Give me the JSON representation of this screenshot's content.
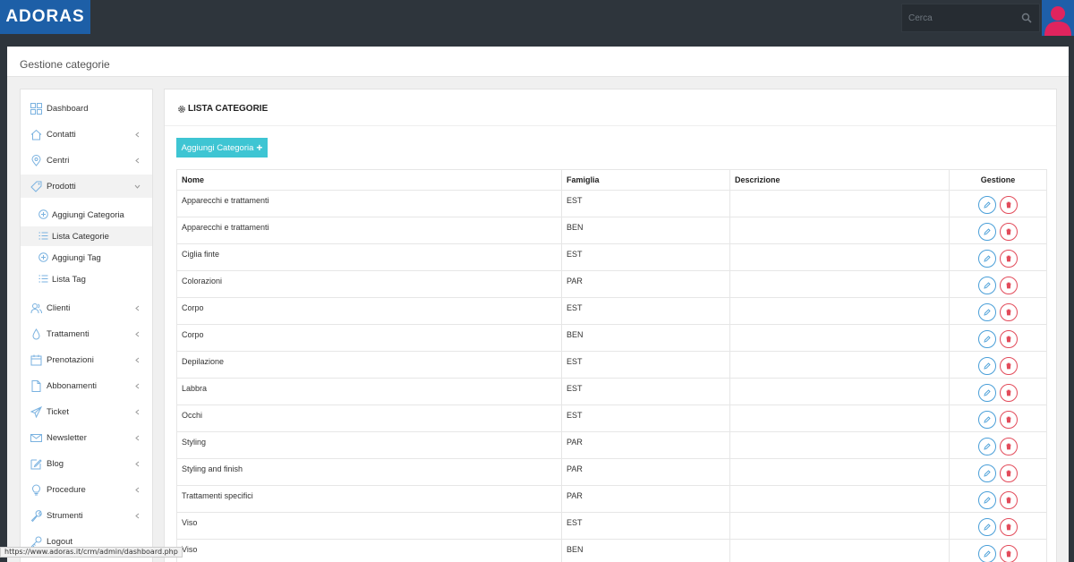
{
  "brand": {
    "logo_text": "ADORAS",
    "logo_color": "#1d5fa7"
  },
  "search": {
    "placeholder": "Cerca",
    "value": ""
  },
  "page": {
    "title": "Gestione categorie"
  },
  "sidebar": {
    "items": [
      {
        "label": "Dashboard",
        "icon": "dashboard-icon",
        "has_submenu": false
      },
      {
        "label": "Contatti",
        "icon": "home-icon",
        "has_submenu": true
      },
      {
        "label": "Centri",
        "icon": "map-pin-icon",
        "has_submenu": true
      },
      {
        "label": "Prodotti",
        "icon": "tag-icon",
        "has_submenu": true,
        "expanded": true,
        "children": [
          {
            "label": "Aggiungi Categoria",
            "icon": "plus-circle-icon"
          },
          {
            "label": "Lista Categorie",
            "icon": "list-icon",
            "active": true
          },
          {
            "label": "Aggiungi Tag",
            "icon": "plus-circle-icon"
          },
          {
            "label": "Lista Tag",
            "icon": "list-icon"
          }
        ]
      },
      {
        "label": "Clienti",
        "icon": "users-icon",
        "has_submenu": true
      },
      {
        "label": "Trattamenti",
        "icon": "drop-icon",
        "has_submenu": true
      },
      {
        "label": "Prenotazioni",
        "icon": "calendar-icon",
        "has_submenu": true
      },
      {
        "label": "Abbonamenti",
        "icon": "document-icon",
        "has_submenu": true
      },
      {
        "label": "Ticket",
        "icon": "paper-plane-icon",
        "has_submenu": true
      },
      {
        "label": "Newsletter",
        "icon": "envelope-icon",
        "has_submenu": true
      },
      {
        "label": "Blog",
        "icon": "edit-icon",
        "has_submenu": true
      },
      {
        "label": "Procedure",
        "icon": "bulb-icon",
        "has_submenu": true
      },
      {
        "label": "Strumenti",
        "icon": "wrench-icon",
        "has_submenu": true
      },
      {
        "label": "Logout",
        "icon": "key-icon",
        "has_submenu": false
      }
    ]
  },
  "panel": {
    "title": "LISTA CATEGORIE",
    "add_button_label": "Aggiungi Categoria",
    "columns": [
      "Nome",
      "Famiglia",
      "Descrizione",
      "Gestione"
    ],
    "rows": [
      {
        "nome": "Apparecchi e trattamenti",
        "famiglia": "EST",
        "descrizione": ""
      },
      {
        "nome": "Apparecchi e trattamenti",
        "famiglia": "BEN",
        "descrizione": ""
      },
      {
        "nome": "Ciglia finte",
        "famiglia": "EST",
        "descrizione": ""
      },
      {
        "nome": "Colorazioni",
        "famiglia": "PAR",
        "descrizione": ""
      },
      {
        "nome": "Corpo",
        "famiglia": "EST",
        "descrizione": ""
      },
      {
        "nome": "Corpo",
        "famiglia": "BEN",
        "descrizione": ""
      },
      {
        "nome": "Depilazione",
        "famiglia": "EST",
        "descrizione": ""
      },
      {
        "nome": "Labbra",
        "famiglia": "EST",
        "descrizione": ""
      },
      {
        "nome": "Occhi",
        "famiglia": "EST",
        "descrizione": ""
      },
      {
        "nome": "Styling",
        "famiglia": "PAR",
        "descrizione": ""
      },
      {
        "nome": "Styling and finish",
        "famiglia": "PAR",
        "descrizione": ""
      },
      {
        "nome": "Trattamenti specifici",
        "famiglia": "PAR",
        "descrizione": ""
      },
      {
        "nome": "Viso",
        "famiglia": "EST",
        "descrizione": ""
      },
      {
        "nome": "Viso",
        "famiglia": "BEN",
        "descrizione": ""
      }
    ]
  },
  "statusbar": {
    "url": "https://www.adoras.it/crm/admin/dashboard.php"
  },
  "colors": {
    "accent": "#3ec5d3",
    "edit": "#4a9fd8",
    "delete": "#e24b5a",
    "topbar": "#2e353c"
  }
}
